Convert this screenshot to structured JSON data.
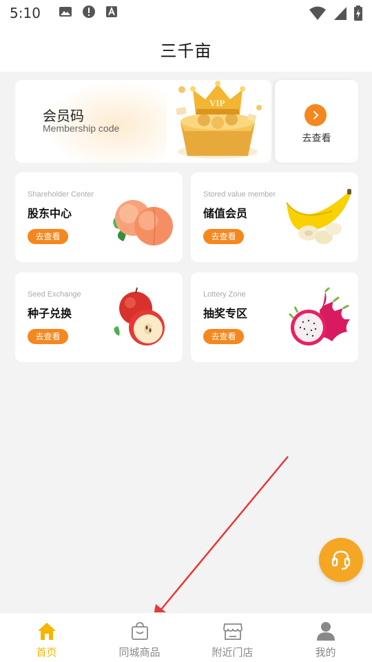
{
  "status_bar": {
    "time": "5:10",
    "left_icons": [
      "image-icon",
      "alert-icon",
      "font-icon"
    ],
    "right_icons": [
      "wifi-icon",
      "signal-icon",
      "battery-icon"
    ]
  },
  "header": {
    "title": "三千亩"
  },
  "member_card": {
    "title": "会员码",
    "subtitle": "Membership code",
    "art_label": "VIP",
    "view_label": "去查看"
  },
  "tiles": [
    {
      "en": "Shareholder Center",
      "cn": "股东中心",
      "button": "去查看",
      "art": "peach-icon"
    },
    {
      "en": "Stored value member",
      "cn": "储值会员",
      "button": "去查看",
      "art": "banana-icon"
    },
    {
      "en": "Seed Exchange",
      "cn": "种子兑换",
      "button": "去查看",
      "art": "apple-icon"
    },
    {
      "en": "Lottery Zone",
      "cn": "抽奖专区",
      "button": "去查看",
      "art": "dragon-fruit-icon"
    }
  ],
  "tabbar": {
    "items": [
      {
        "label": "首页",
        "icon": "home-icon",
        "active": true
      },
      {
        "label": "同城商品",
        "icon": "shopping-bag-icon",
        "active": false
      },
      {
        "label": "附近门店",
        "icon": "store-icon",
        "active": false
      },
      {
        "label": "我的",
        "icon": "user-icon",
        "active": false
      }
    ]
  },
  "colors": {
    "accent": "#f5871f",
    "active_tab": "#f5b500",
    "support_button": "#f5a623",
    "annotation_arrow": "#e53935"
  }
}
